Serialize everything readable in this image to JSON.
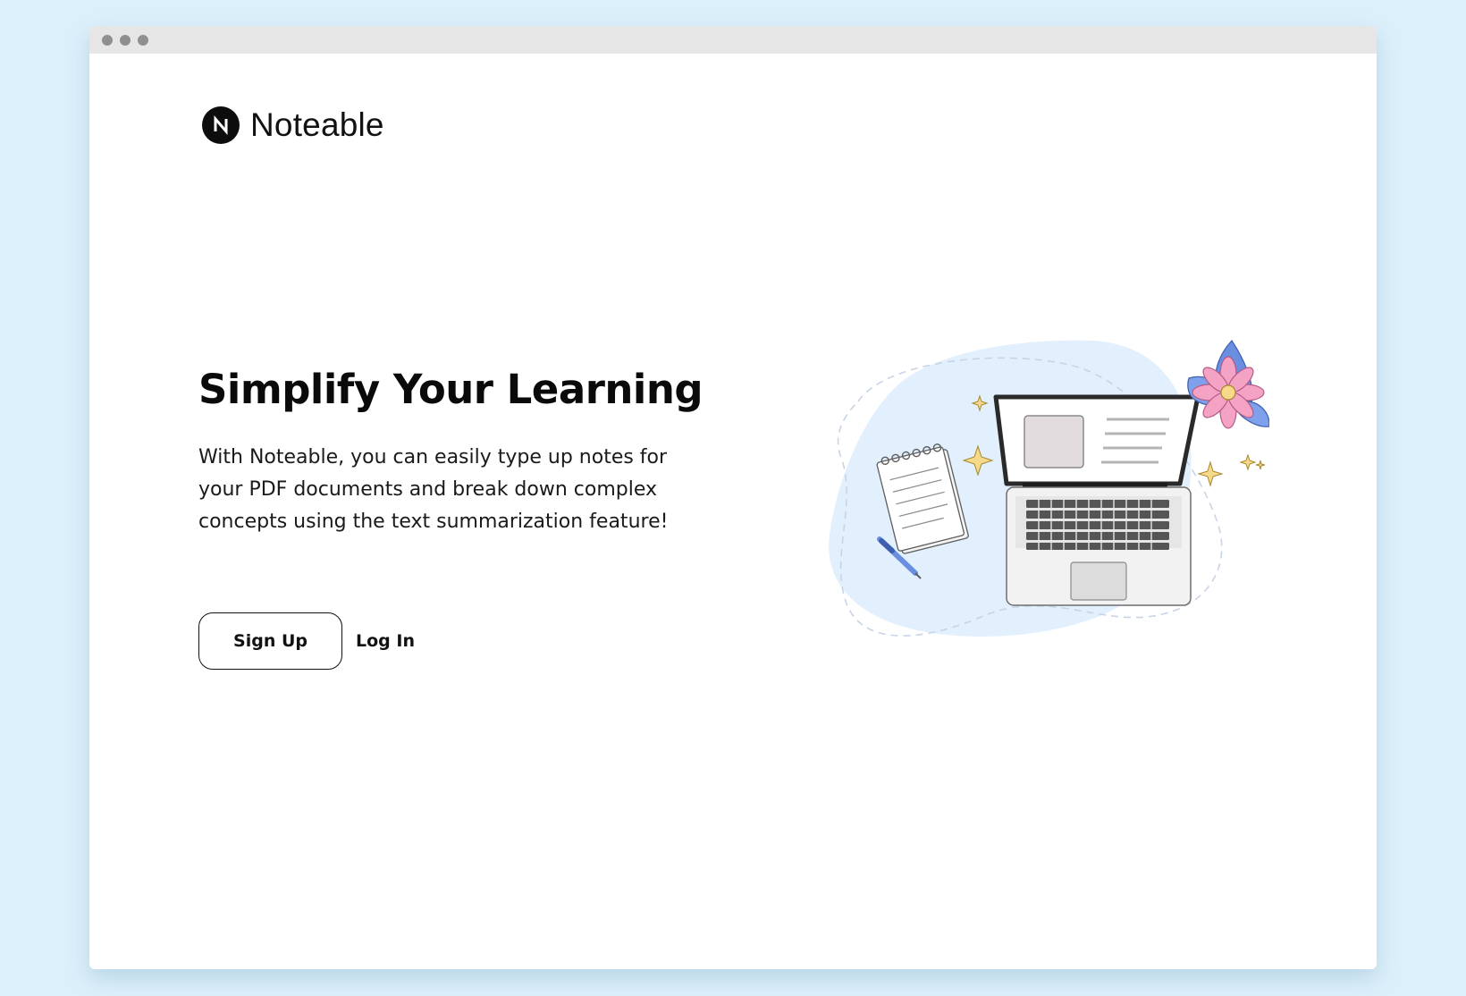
{
  "window": {
    "controls": [
      "window-dot",
      "window-dot",
      "window-dot"
    ]
  },
  "brand": {
    "name": "Noteable",
    "icon": "noteable-logo-icon"
  },
  "hero": {
    "title": "Simplify Your Learning",
    "description": "With Noteable, you can easily type up notes for your PDF documents and break down complex concepts using the text summarization feature!"
  },
  "actions": {
    "signup_label": "Sign Up",
    "login_label": "Log In"
  },
  "illustration": {
    "icons": [
      "laptop-icon",
      "notebook-icon",
      "pen-icon",
      "flower-icon",
      "sparkle-icon"
    ]
  },
  "colors": {
    "page_background": "#dcf0fb",
    "window_background": "#ffffff",
    "titlebar": "#e6e6e6",
    "text": "#0a0a0a",
    "blob": "#e2effc",
    "flower_petals": "#f4a3c4",
    "flower_leaves": "#6a8fe0",
    "sparkles": "#f6d98a"
  }
}
